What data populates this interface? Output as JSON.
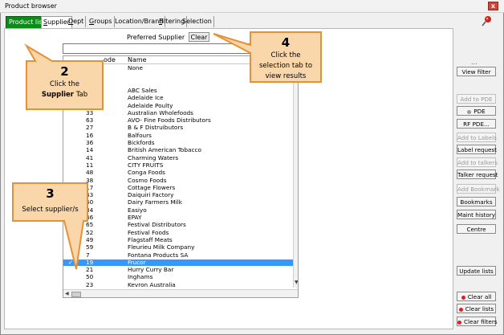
{
  "window": {
    "title": "Product browser",
    "close": "x"
  },
  "tabs": [
    {
      "label": "Product list",
      "mnemonic": "",
      "rest": ""
    },
    {
      "label": "",
      "mnemonic": "S",
      "rest": "upplier"
    },
    {
      "label": "",
      "mnemonic": "D",
      "rest": "ept"
    },
    {
      "label": "",
      "mnemonic": "G",
      "rest": "roups"
    },
    {
      "label": "",
      "mnemonic": "",
      "rest": "Location/Brand"
    },
    {
      "label": "",
      "mnemonic": "F",
      "rest": "iltering"
    },
    {
      "label": "",
      "mnemonic": "",
      "rest": "Selection"
    }
  ],
  "supplier_panel": {
    "preferred_label": "Preferred Supplier",
    "clear_label": "Clear",
    "filter_value": "",
    "header_code": "ode",
    "header_name": "Name",
    "rows": [
      {
        "check": "",
        "code": "",
        "name": "None"
      },
      {
        "check": "",
        "code": "",
        "name": ""
      },
      {
        "check": "",
        "code": "",
        "name": ""
      },
      {
        "check": "",
        "code": "",
        "name": "ABC Sales"
      },
      {
        "check": "",
        "code": "",
        "name": "Adelaide Ice"
      },
      {
        "check": "",
        "code": "",
        "name": "Adelaide Poulty"
      },
      {
        "check": "",
        "code": "33",
        "name": "Australian Wholefoods"
      },
      {
        "check": "",
        "code": "63",
        "name": "AVO- Fine Foods Distributors"
      },
      {
        "check": "",
        "code": "27",
        "name": "B & F Distruibutors"
      },
      {
        "check": "",
        "code": "16",
        "name": "Balfours"
      },
      {
        "check": "",
        "code": "36",
        "name": "Bickfords"
      },
      {
        "check": "",
        "code": "14",
        "name": "British American Tobacco"
      },
      {
        "check": "",
        "code": "41",
        "name": "Charming Waters"
      },
      {
        "check": "",
        "code": "11",
        "name": "CITY FRUITS"
      },
      {
        "check": "",
        "code": "48",
        "name": "Conga Foods"
      },
      {
        "check": "",
        "code": "38",
        "name": "Cosmo Foods"
      },
      {
        "check": "",
        "code": "17",
        "name": "Cottage Flowers"
      },
      {
        "check": "",
        "code": "43",
        "name": "Daiquiri Factory"
      },
      {
        "check": "",
        "code": "60",
        "name": "Dairy Farmers Milk"
      },
      {
        "check": "",
        "code": "34",
        "name": "Easiyo"
      },
      {
        "check": "",
        "code": "46",
        "name": "EPAY"
      },
      {
        "check": "",
        "code": "65",
        "name": "Festival Distributors"
      },
      {
        "check": "",
        "code": "52",
        "name": "Festival Foods"
      },
      {
        "check": "",
        "code": "49",
        "name": "Flagstaff Meats"
      },
      {
        "check": "",
        "code": "59",
        "name": "Fleurieu Milk Company"
      },
      {
        "check": "",
        "code": "7",
        "name": "Fontana Products SA"
      },
      {
        "check": "✓",
        "code": "19",
        "name": "Frucor",
        "selected": true
      },
      {
        "check": "",
        "code": "21",
        "name": "Hurry Curry Bar"
      },
      {
        "check": "",
        "code": "50",
        "name": "Inghams"
      },
      {
        "check": "",
        "code": "23",
        "name": "Kevron Australia"
      }
    ]
  },
  "side_buttons": [
    {
      "label": "View filter",
      "disabled": false,
      "dot": ""
    },
    {
      "label": "Add to PDE",
      "disabled": true,
      "dot": ""
    },
    {
      "label": "PDE",
      "disabled": false,
      "dot": "#9a9a9a"
    },
    {
      "label": "RF PDE...",
      "disabled": false,
      "dot": ""
    },
    {
      "label": "Add to Labels",
      "disabled": true,
      "dot": ""
    },
    {
      "label": "Label request",
      "disabled": false,
      "dot": ""
    },
    {
      "label": "Add to talkers",
      "disabled": true,
      "dot": ""
    },
    {
      "label": "Talker request",
      "disabled": false,
      "dot": ""
    },
    {
      "label": "Add Bookmark",
      "disabled": true,
      "dot": ""
    },
    {
      "label": "Bookmarks",
      "disabled": false,
      "dot": ""
    },
    {
      "label": "Maint history",
      "disabled": false,
      "dot": ""
    },
    {
      "label": "Centre",
      "disabled": false,
      "dot": ""
    },
    {
      "label": "Update lists",
      "disabled": false,
      "dot": ""
    },
    {
      "label": "Clear all",
      "disabled": false,
      "dot": "#e02020"
    },
    {
      "label": "Clear lists",
      "disabled": false,
      "dot": "#e02020"
    },
    {
      "label": "Clear filters",
      "disabled": false,
      "dot": "#e02020"
    }
  ],
  "side_dots": "...",
  "callouts": {
    "c2": {
      "number": "2",
      "line1": "Click the",
      "bold": "Supplier",
      "rest": " Tab"
    },
    "c3": {
      "number": "3",
      "text": "Select supplier/s"
    },
    "c4": {
      "number": "4",
      "line1": "Click the",
      "line2": "selection tab to",
      "line3": "view results"
    }
  },
  "colors": {
    "accent_green": "#0c8a19",
    "selection_blue": "#3399ff",
    "callout_fill": "#fad7ab",
    "callout_border": "#e59136"
  }
}
